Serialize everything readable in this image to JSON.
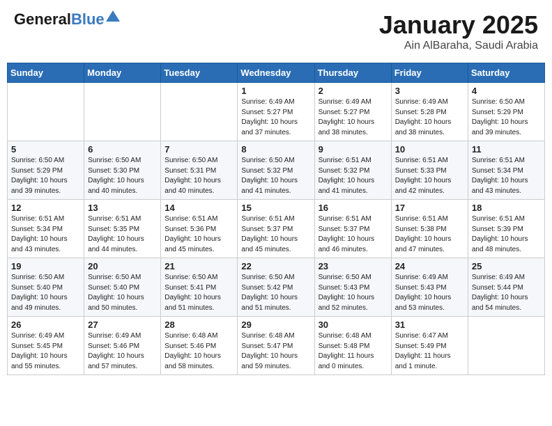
{
  "header": {
    "logo_line1": "General",
    "logo_line2": "Blue",
    "month_title": "January 2025",
    "location": "Ain AlBaraha, Saudi Arabia"
  },
  "weekdays": [
    "Sunday",
    "Monday",
    "Tuesday",
    "Wednesday",
    "Thursday",
    "Friday",
    "Saturday"
  ],
  "weeks": [
    [
      {
        "day": "",
        "info": ""
      },
      {
        "day": "",
        "info": ""
      },
      {
        "day": "",
        "info": ""
      },
      {
        "day": "1",
        "info": "Sunrise: 6:49 AM\nSunset: 5:27 PM\nDaylight: 10 hours\nand 37 minutes."
      },
      {
        "day": "2",
        "info": "Sunrise: 6:49 AM\nSunset: 5:27 PM\nDaylight: 10 hours\nand 38 minutes."
      },
      {
        "day": "3",
        "info": "Sunrise: 6:49 AM\nSunset: 5:28 PM\nDaylight: 10 hours\nand 38 minutes."
      },
      {
        "day": "4",
        "info": "Sunrise: 6:50 AM\nSunset: 5:29 PM\nDaylight: 10 hours\nand 39 minutes."
      }
    ],
    [
      {
        "day": "5",
        "info": "Sunrise: 6:50 AM\nSunset: 5:29 PM\nDaylight: 10 hours\nand 39 minutes."
      },
      {
        "day": "6",
        "info": "Sunrise: 6:50 AM\nSunset: 5:30 PM\nDaylight: 10 hours\nand 40 minutes."
      },
      {
        "day": "7",
        "info": "Sunrise: 6:50 AM\nSunset: 5:31 PM\nDaylight: 10 hours\nand 40 minutes."
      },
      {
        "day": "8",
        "info": "Sunrise: 6:50 AM\nSunset: 5:32 PM\nDaylight: 10 hours\nand 41 minutes."
      },
      {
        "day": "9",
        "info": "Sunrise: 6:51 AM\nSunset: 5:32 PM\nDaylight: 10 hours\nand 41 minutes."
      },
      {
        "day": "10",
        "info": "Sunrise: 6:51 AM\nSunset: 5:33 PM\nDaylight: 10 hours\nand 42 minutes."
      },
      {
        "day": "11",
        "info": "Sunrise: 6:51 AM\nSunset: 5:34 PM\nDaylight: 10 hours\nand 43 minutes."
      }
    ],
    [
      {
        "day": "12",
        "info": "Sunrise: 6:51 AM\nSunset: 5:34 PM\nDaylight: 10 hours\nand 43 minutes."
      },
      {
        "day": "13",
        "info": "Sunrise: 6:51 AM\nSunset: 5:35 PM\nDaylight: 10 hours\nand 44 minutes."
      },
      {
        "day": "14",
        "info": "Sunrise: 6:51 AM\nSunset: 5:36 PM\nDaylight: 10 hours\nand 45 minutes."
      },
      {
        "day": "15",
        "info": "Sunrise: 6:51 AM\nSunset: 5:37 PM\nDaylight: 10 hours\nand 45 minutes."
      },
      {
        "day": "16",
        "info": "Sunrise: 6:51 AM\nSunset: 5:37 PM\nDaylight: 10 hours\nand 46 minutes."
      },
      {
        "day": "17",
        "info": "Sunrise: 6:51 AM\nSunset: 5:38 PM\nDaylight: 10 hours\nand 47 minutes."
      },
      {
        "day": "18",
        "info": "Sunrise: 6:51 AM\nSunset: 5:39 PM\nDaylight: 10 hours\nand 48 minutes."
      }
    ],
    [
      {
        "day": "19",
        "info": "Sunrise: 6:50 AM\nSunset: 5:40 PM\nDaylight: 10 hours\nand 49 minutes."
      },
      {
        "day": "20",
        "info": "Sunrise: 6:50 AM\nSunset: 5:40 PM\nDaylight: 10 hours\nand 50 minutes."
      },
      {
        "day": "21",
        "info": "Sunrise: 6:50 AM\nSunset: 5:41 PM\nDaylight: 10 hours\nand 51 minutes."
      },
      {
        "day": "22",
        "info": "Sunrise: 6:50 AM\nSunset: 5:42 PM\nDaylight: 10 hours\nand 51 minutes."
      },
      {
        "day": "23",
        "info": "Sunrise: 6:50 AM\nSunset: 5:43 PM\nDaylight: 10 hours\nand 52 minutes."
      },
      {
        "day": "24",
        "info": "Sunrise: 6:49 AM\nSunset: 5:43 PM\nDaylight: 10 hours\nand 53 minutes."
      },
      {
        "day": "25",
        "info": "Sunrise: 6:49 AM\nSunset: 5:44 PM\nDaylight: 10 hours\nand 54 minutes."
      }
    ],
    [
      {
        "day": "26",
        "info": "Sunrise: 6:49 AM\nSunset: 5:45 PM\nDaylight: 10 hours\nand 55 minutes."
      },
      {
        "day": "27",
        "info": "Sunrise: 6:49 AM\nSunset: 5:46 PM\nDaylight: 10 hours\nand 57 minutes."
      },
      {
        "day": "28",
        "info": "Sunrise: 6:48 AM\nSunset: 5:46 PM\nDaylight: 10 hours\nand 58 minutes."
      },
      {
        "day": "29",
        "info": "Sunrise: 6:48 AM\nSunset: 5:47 PM\nDaylight: 10 hours\nand 59 minutes."
      },
      {
        "day": "30",
        "info": "Sunrise: 6:48 AM\nSunset: 5:48 PM\nDaylight: 11 hours\nand 0 minutes."
      },
      {
        "day": "31",
        "info": "Sunrise: 6:47 AM\nSunset: 5:49 PM\nDaylight: 11 hours\nand 1 minute."
      },
      {
        "day": "",
        "info": ""
      }
    ]
  ]
}
